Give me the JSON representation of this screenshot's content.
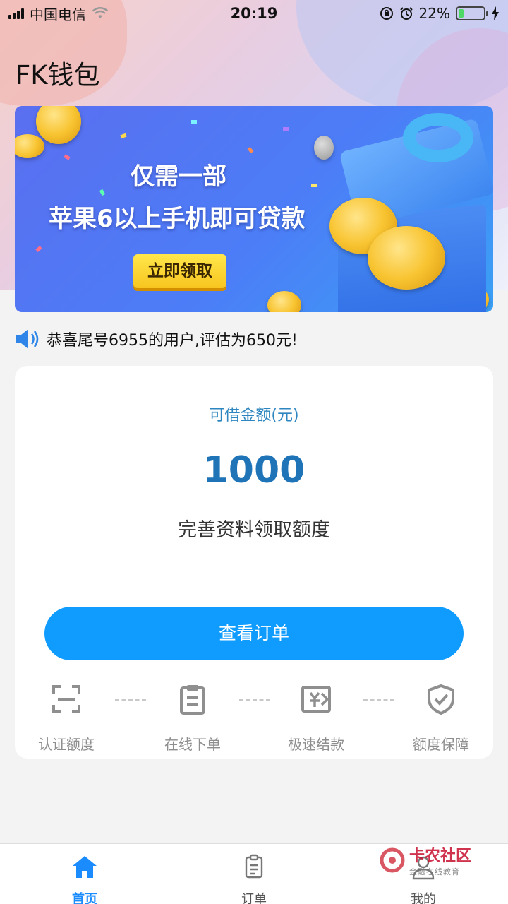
{
  "status_bar": {
    "carrier": "中国电信",
    "time": "20:19",
    "battery_percent": "22%",
    "battery_level": 0.22
  },
  "app": {
    "title": "FK钱包"
  },
  "banner": {
    "line1": "仅需一部",
    "line2": "苹果6以上手机即可贷款",
    "button": "立即领取"
  },
  "notice": {
    "text": "恭喜尾号6955的用户,评估为650元!"
  },
  "card": {
    "label": "可借金额(元)",
    "amount": "1000",
    "subtitle": "完善资料领取额度",
    "button": "查看订单"
  },
  "steps": [
    {
      "label": "认证额度",
      "icon": "scan-frame-icon"
    },
    {
      "label": "在线下单",
      "icon": "clipboard-icon"
    },
    {
      "label": "极速结款",
      "icon": "money-transfer-icon"
    },
    {
      "label": "额度保障",
      "icon": "shield-check-icon"
    }
  ],
  "tabbar": {
    "items": [
      {
        "label": "首页",
        "icon": "home-icon",
        "active": true
      },
      {
        "label": "订单",
        "icon": "document-icon",
        "active": false
      },
      {
        "label": "我的",
        "icon": "user-icon",
        "active": false
      }
    ],
    "active_color": "#1a8cff",
    "inactive_color": "#555555"
  },
  "watermark": {
    "text1": "卡农社区",
    "text2": "金融在线教育"
  }
}
